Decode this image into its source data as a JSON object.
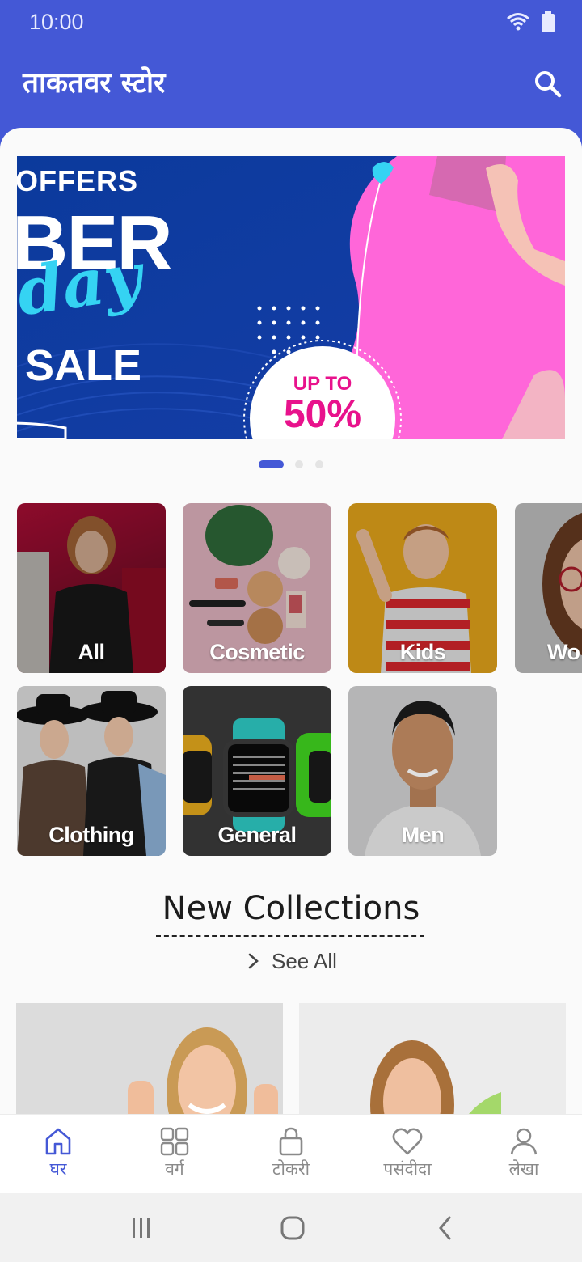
{
  "status_bar": {
    "time": "10:00",
    "icons": [
      "wifi-icon",
      "battery-icon"
    ]
  },
  "app_bar": {
    "title": "ताकतवर स्टोर",
    "search_icon": "search-icon"
  },
  "banner": {
    "offers": "OFFERS",
    "big": "BER",
    "script": "day",
    "sale": "SALE",
    "badge_top": "UP TO",
    "badge_value": "50%",
    "page_count": 3,
    "active_page": 1
  },
  "categories": [
    {
      "label": "All"
    },
    {
      "label": "Cosmetic"
    },
    {
      "label": "Kids"
    },
    {
      "label": "Wo"
    },
    {
      "label": "Clothing"
    },
    {
      "label": "General"
    },
    {
      "label": "Men"
    }
  ],
  "new_collections": {
    "title": "New Collections",
    "see_all": "See All"
  },
  "bottom_nav": [
    {
      "label": "घर",
      "icon": "home-icon",
      "active": true
    },
    {
      "label": "वर्ग",
      "icon": "grid-icon",
      "active": false
    },
    {
      "label": "टोकरी",
      "icon": "bag-icon",
      "active": false
    },
    {
      "label": "पसंदीदा",
      "icon": "heart-icon",
      "active": false
    },
    {
      "label": "लेखा",
      "icon": "user-icon",
      "active": false
    }
  ],
  "system_nav": [
    "recents-icon",
    "home-button-icon",
    "back-icon"
  ],
  "colors": {
    "primary": "#4458d6",
    "nav_inactive": "#8a8a8a",
    "badge_pink": "#e8128c"
  }
}
